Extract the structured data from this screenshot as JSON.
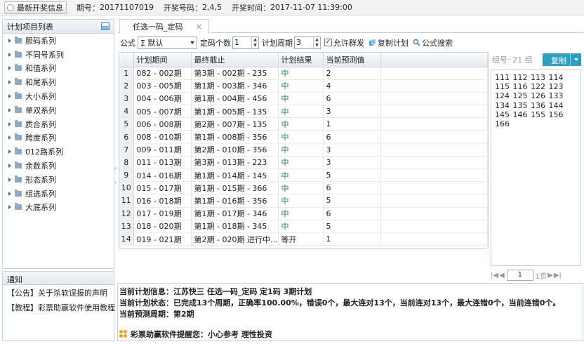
{
  "topbar": {
    "latest_button": "最新开奖信息",
    "period_label": "期号：",
    "period_value": "20171107019",
    "numbers_label": "开奖号码：",
    "numbers_value": "2,4,5",
    "time_label": "开奖时间：",
    "time_value": "2017-11-07 11:39:00"
  },
  "sidebar": {
    "title": "计划项目列表",
    "items": [
      {
        "label": "胆码系列"
      },
      {
        "label": "不同号系列"
      },
      {
        "label": "和值系列"
      },
      {
        "label": "和尾系列"
      },
      {
        "label": "大小系列"
      },
      {
        "label": "单双系列"
      },
      {
        "label": "质合系列"
      },
      {
        "label": "跨度系列"
      },
      {
        "label": "012路系列"
      },
      {
        "label": "余数系列"
      },
      {
        "label": "形态系列"
      },
      {
        "label": "组选系列"
      },
      {
        "label": "大底系列"
      }
    ]
  },
  "notice": {
    "title": "通知",
    "items": [
      {
        "label": "【公告】关于杀软误报的声明"
      },
      {
        "label": "【教程】彩票助赢软件使用教程"
      }
    ]
  },
  "tab": {
    "label": "任选一码_定码",
    "close": "×"
  },
  "toolbar": {
    "formula_label": "公式",
    "formula_value": "Σ 默认",
    "count_label": "定码个数",
    "count_value": "1",
    "cycle_label": "计划周期",
    "cycle_value": "3",
    "allow_label": "允许群发",
    "copy_plan": "复制计划",
    "search": "公式搜索"
  },
  "grid": {
    "headers": [
      "计划期间",
      "最终截止",
      "计划结果",
      "当前预测值"
    ],
    "rows": [
      {
        "n": "1",
        "period": "082 - 002期",
        "end": "第3期 - 002期 - 235",
        "result": "中",
        "pred": "2"
      },
      {
        "n": "2",
        "period": "003 - 005期",
        "end": "第1期 - 003期 - 346",
        "result": "中",
        "pred": "4"
      },
      {
        "n": "3",
        "period": "004 - 006期",
        "end": "第1期 - 004期 - 456",
        "result": "中",
        "pred": "6"
      },
      {
        "n": "4",
        "period": "005 - 007期",
        "end": "第1期 - 005期 - 135",
        "result": "中",
        "pred": "3"
      },
      {
        "n": "5",
        "period": "006 - 008期",
        "end": "第2期 - 007期 - 135",
        "result": "中",
        "pred": "1"
      },
      {
        "n": "6",
        "period": "008 - 010期",
        "end": "第1期 - 008期 - 356",
        "result": "中",
        "pred": "6"
      },
      {
        "n": "7",
        "period": "009 - 011期",
        "end": "第2期 - 010期 - 356",
        "result": "中",
        "pred": "3"
      },
      {
        "n": "8",
        "period": "011 - 013期",
        "end": "第3期 - 013期 - 223",
        "result": "中",
        "pred": "3"
      },
      {
        "n": "9",
        "period": "014 - 016期",
        "end": "第1期 - 014期 - 145",
        "result": "中",
        "pred": "5"
      },
      {
        "n": "10",
        "period": "015 - 017期",
        "end": "第1期 - 015期 - 366",
        "result": "中",
        "pred": "6"
      },
      {
        "n": "11",
        "period": "016 - 018期",
        "end": "第1期 - 016期 - 356",
        "result": "中",
        "pred": "5"
      },
      {
        "n": "12",
        "period": "017 - 019期",
        "end": "第1期 - 017期 - 346",
        "result": "中",
        "pred": "6"
      },
      {
        "n": "13",
        "period": "018 - 020期",
        "end": "第1期 - 018期 - 345",
        "result": "中",
        "pred": "5"
      },
      {
        "n": "14",
        "period": "019 - 021期",
        "end": "第2期 - 020期 进行中...",
        "result": "等开",
        "pred": "1"
      }
    ]
  },
  "group": {
    "label": "组号: 21 组",
    "copy": "复制",
    "numbers": "111 112 113 114 115 116 122 123 124 125 126 133 134 135 136 144 145 146 155 156 166"
  },
  "pager": {
    "page": "1",
    "total": "1页"
  },
  "info": {
    "line1_label": "当前计划信息：",
    "line1_value": "江苏快三   任选一码_定码   定1码   3期计划",
    "line2_label": "当前计划状态：",
    "line2_value": "已完成13个周期，正确率100.00%，错误0个，最大连对13个，当前连对13个，最大连错0个，当前连错0个。",
    "line3_label": "当前预测周期：",
    "line3_value": "第2期",
    "tip": "彩票助赢软件提醒您：小心参考   理性投资"
  },
  "colors": {
    "accent": "#2f9fbf",
    "hit": "#1a8a3a",
    "border": "#c9d3df"
  }
}
